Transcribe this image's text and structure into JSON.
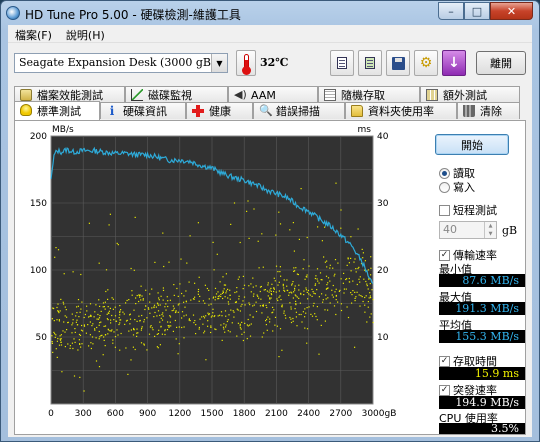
{
  "window": {
    "title": "HD Tune Pro  5.00 - 硬碟檢測-維護工具",
    "minimize": "–",
    "maximize": "□",
    "close": "✕"
  },
  "menu": {
    "items": [
      "檔案(F)",
      "說明(H)"
    ]
  },
  "toolbar": {
    "drive": "Seagate Expansion Desk   (3000 gB)",
    "temperature": "32℃",
    "exit_label": "離開",
    "icons": [
      "copy-text-icon",
      "copy-screenshot-icon",
      "save-icon",
      "options-icon",
      "download-icon"
    ]
  },
  "tabs": {
    "row1": [
      {
        "label": "檔案效能測試",
        "icon": "file-benchmark-icon"
      },
      {
        "label": "磁碟監視",
        "icon": "disk-monitor-icon"
      },
      {
        "label": "AAM",
        "icon": "speaker-icon"
      },
      {
        "label": "隨機存取",
        "icon": "random-access-icon"
      },
      {
        "label": "額外測試",
        "icon": "extra-tests-icon"
      }
    ],
    "row2": [
      {
        "label": "標準測試",
        "icon": "bulb-icon",
        "active": true
      },
      {
        "label": "硬碟資訊",
        "icon": "info-icon"
      },
      {
        "label": "健康",
        "icon": "health-cross-icon"
      },
      {
        "label": "錯誤掃描",
        "icon": "magnifier-icon"
      },
      {
        "label": "資料夾使用率",
        "icon": "folder-icon"
      },
      {
        "label": "清除",
        "icon": "trash-icon"
      }
    ]
  },
  "panel": {
    "start_label": "開始",
    "read_label": "讀取",
    "write_label": "寫入",
    "read_selected": true,
    "short_test_label": "短程測試",
    "short_test_checked": false,
    "short_test_value": "40",
    "short_test_unit": "gB",
    "transfer_rate_label": "傳輸速率",
    "transfer_rate_checked": true,
    "min_label": "最小值",
    "min_value": "87.6 MB/s",
    "max_label": "最大值",
    "max_value": "191.3 MB/s",
    "avg_label": "平均值",
    "avg_value": "155.3 MB/s",
    "access_time_label": "存取時間",
    "access_time_checked": true,
    "access_time_value": "15.9 ms",
    "burst_rate_label": "突發速率",
    "burst_rate_checked": true,
    "burst_rate_value": "194.9 MB/s",
    "cpu_label": "CPU 使用率",
    "cpu_value": "3.5%"
  },
  "chart_data": {
    "type": "line",
    "title": "",
    "y_left_label": "MB/s",
    "y_right_label": "ms",
    "x_unit": "gB",
    "xlim": [
      0,
      3000
    ],
    "ylim_left": [
      0,
      200
    ],
    "ylim_right": [
      0,
      40
    ],
    "x_ticks": [
      0,
      300,
      600,
      900,
      1200,
      1500,
      1800,
      2100,
      2400,
      2700,
      3000
    ],
    "y_left_ticks": [
      50,
      100,
      150,
      200
    ],
    "y_right_ticks": [
      10,
      20,
      30,
      40
    ],
    "grid": true,
    "colors": {
      "transfer": "#2eaad8",
      "access": "#e8e800",
      "background": "#323232",
      "grid": "#5a5a5a"
    },
    "series": [
      {
        "name": "傳輸速率",
        "axis": "left",
        "x": [
          0,
          30,
          60,
          100,
          150,
          200,
          300,
          400,
          500,
          600,
          700,
          800,
          900,
          1000,
          1100,
          1200,
          1300,
          1400,
          1500,
          1600,
          1700,
          1800,
          1900,
          2000,
          2100,
          2200,
          2300,
          2400,
          2500,
          2600,
          2700,
          2800,
          2900,
          3000
        ],
        "values": [
          168,
          186,
          189,
          188,
          190,
          188,
          189,
          189,
          188,
          187,
          187,
          186,
          186,
          184,
          182,
          182,
          181,
          178,
          176,
          172,
          169,
          167,
          164,
          160,
          157,
          154,
          148,
          144,
          138,
          133,
          126,
          118,
          106,
          88
        ]
      },
      {
        "name": "存取時間",
        "axis": "right",
        "x_range": [
          0,
          3000
        ],
        "y_range_start": [
          8,
          14
        ],
        "y_range_end": [
          14,
          22
        ],
        "count": 900
      }
    ]
  }
}
